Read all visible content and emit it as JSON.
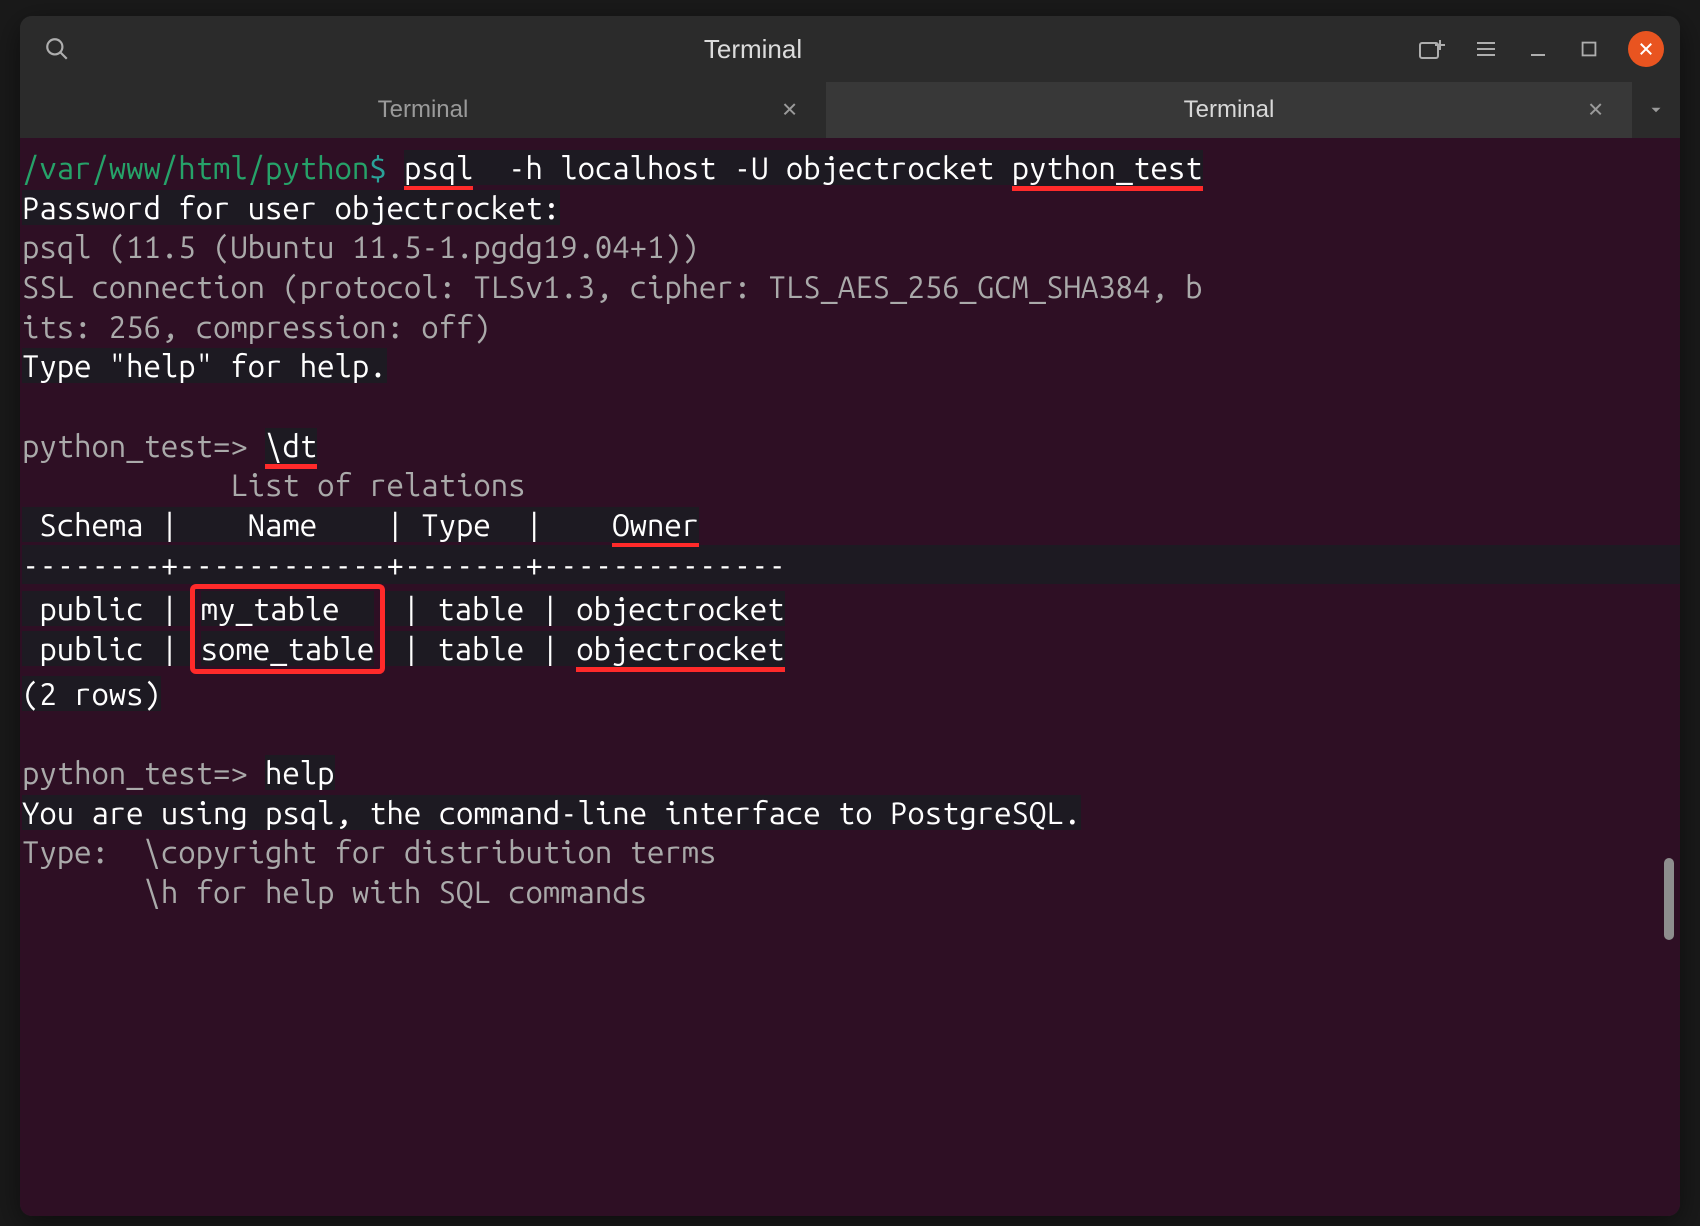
{
  "window": {
    "title": "Terminal"
  },
  "tabs": [
    {
      "label": "Terminal",
      "active": false
    },
    {
      "label": "Terminal",
      "active": true
    }
  ],
  "colors": {
    "prompt_path": "#26a269",
    "prompt_symbol": "#2aa198",
    "annotation_red": "#ff2a2a",
    "close_button": "#E95420",
    "term_bg": "#2e0f24"
  },
  "terminal": {
    "prompt_path": "/var/www/html/python",
    "prompt_symbol": "$",
    "command1_parts": {
      "psql": "psql",
      "flags": "  -h localhost -U objectrocket ",
      "dbname": "python_test"
    },
    "password_prompt": "Password for user objectrocket:",
    "psql_version": "psql (11.5 (Ubuntu 11.5-1.pgdg19.04+1))",
    "ssl_line_a": "SSL connection (protocol: TLSv1.3, cipher: TLS_AES_256_GCM_SHA384, b",
    "ssl_line_b": "its: 256, compression: off)",
    "type_help": "Type \"help\" for help.",
    "psql_prompt": "python_test=> ",
    "cmd_dt": "\\dt",
    "relations_title": "            List of relations",
    "table_header": " Schema |    Name    | Type  |    Owner",
    "table_header_owner": "Owner",
    "table_header_pre": " Schema |    Name    | Type  |    ",
    "table_divider": "--------+------------+-------+--------------",
    "row1_pre": " public | ",
    "row1_name": "my_table  ",
    "row1_post": " | table | objectrocket",
    "row2_pre": " public | ",
    "row2_name": "some_table",
    "row2_post": " | table | ",
    "row2_owner": "objectrocket",
    "rows_count": "(2 rows)",
    "cmd_help": "help",
    "help_line1": "You are using psql, the command-line interface to PostgreSQL.",
    "help_line2": "Type:  \\copyright for distribution terms",
    "help_line3": "       \\h for help with SQL commands"
  }
}
